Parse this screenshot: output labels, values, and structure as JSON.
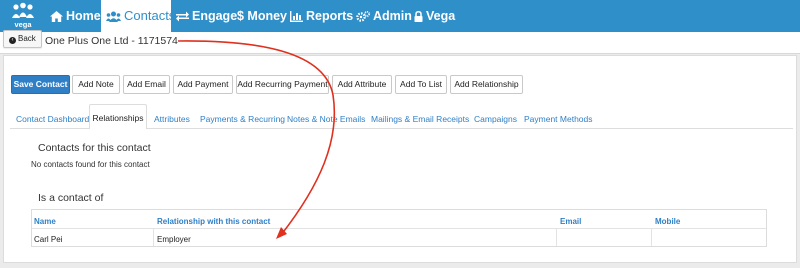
{
  "nav": {
    "logo_text": "vega",
    "items": [
      {
        "label": "Home"
      },
      {
        "label": "Contacts"
      },
      {
        "label": "Engage"
      },
      {
        "label": "$ Money"
      },
      {
        "label": "Reports"
      },
      {
        "label": "Admin"
      },
      {
        "label": "Vega"
      }
    ]
  },
  "header": {
    "back_label": "Back",
    "contact_title": "One Plus One Ltd - 1171574"
  },
  "toolbar": {
    "buttons": [
      {
        "label": "Save Contact"
      },
      {
        "label": "Add Note"
      },
      {
        "label": "Add Email"
      },
      {
        "label": "Add Payment"
      },
      {
        "label": "Add Recurring Payment"
      },
      {
        "label": "Add Attribute"
      },
      {
        "label": "Add To List"
      },
      {
        "label": "Add Relationship"
      }
    ]
  },
  "tabs": [
    {
      "label": "Contact Dashboard"
    },
    {
      "label": "Relationships",
      "active": true
    },
    {
      "label": "Attributes"
    },
    {
      "label": "Payments & Recurring"
    },
    {
      "label": "Notes & Note Emails"
    },
    {
      "label": "Mailings & Email Receipts"
    },
    {
      "label": "Campaigns"
    },
    {
      "label": "Payment Methods"
    }
  ],
  "relationships": {
    "contacts_heading": "Contacts for this contact",
    "contacts_empty": "No contacts found for this contact",
    "is_contact_heading": "Is a contact of",
    "table": {
      "columns": [
        "Name",
        "Relationship with this contact",
        "Email",
        "Mobile"
      ],
      "rows": [
        {
          "name": "Carl Pei",
          "relationship": "Employer",
          "email": "",
          "mobile": ""
        }
      ]
    }
  },
  "colors": {
    "brand": "#2f8fc9",
    "link": "#2f7fc6",
    "annotation_arrow": "#e0301e"
  }
}
